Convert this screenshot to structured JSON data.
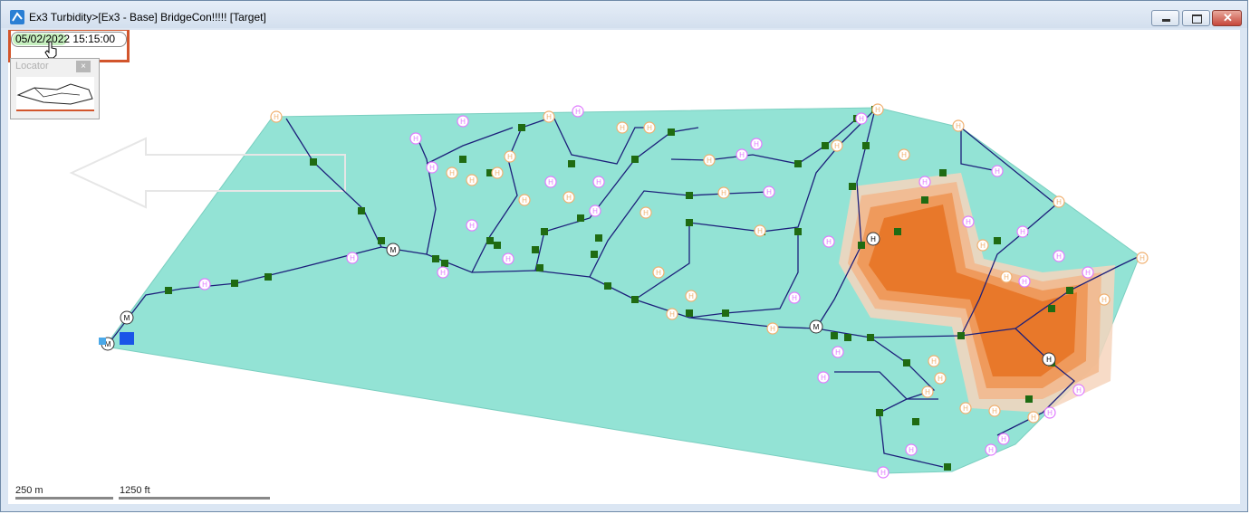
{
  "window": {
    "title": "Ex3 Turbidity>[Ex3 - Base] BridgeCon!!!!!  [Target]",
    "app_icon": "network-app-icon",
    "controls": {
      "minimize": "minimize-icon",
      "maximize": "maximize-icon",
      "close": "close-icon",
      "close_glyph": "✕"
    }
  },
  "time_display": {
    "value": "05/02/2022 15:15:00"
  },
  "locator": {
    "title": "Locator",
    "close_glyph": "×"
  },
  "scale": {
    "metric": "250 m",
    "imperial": "1250 ft"
  },
  "map": {
    "background": "#ffffff",
    "area_fill": "#93e3d5",
    "contour_colors": [
      "#e8782a",
      "#ef9a5c",
      "#f2b98f",
      "#f6d5bd"
    ],
    "pipe_color": "#1c1f7a",
    "node_color": "#1f6b12",
    "hydrant_colors": [
      "#e07bff",
      "#f0b070"
    ],
    "meter_label": "M",
    "hydrant_label": "H",
    "reservoir_color": "#1a55e8"
  }
}
